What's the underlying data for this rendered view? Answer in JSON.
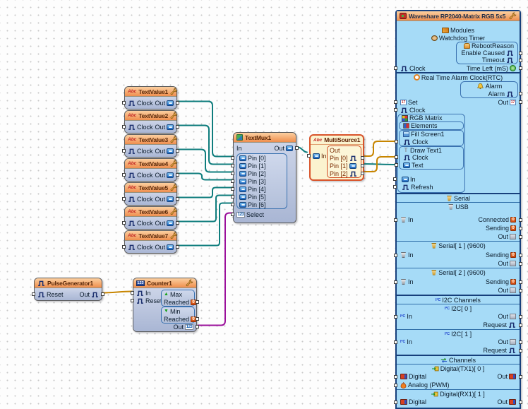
{
  "labels": {
    "clock": "Clock",
    "out": "Out",
    "in": "In",
    "reset": "Reset",
    "select": "Select",
    "text": "Text",
    "refresh": "Refresh",
    "set": "Set",
    "alarm": "Alarm",
    "max": "Max",
    "min": "Min",
    "reached": "Reached",
    "sending": "Sending",
    "connected": "Connected",
    "request": "Request",
    "digital": "Digital",
    "analog": "Analog (PWM)",
    "reboot_reason": "RebootReason",
    "enable_caused": "Enable Caused",
    "timeout": "Timeout",
    "time_left": "Time Left (mS)"
  },
  "text_values": [
    "TextValue1",
    "TextValue2",
    "TextValue3",
    "TextValue4",
    "TextValue5",
    "TextValue6",
    "TextValue7"
  ],
  "text_mux": {
    "title": "TextMux1",
    "pins": [
      "Pin [0]",
      "Pin [1]",
      "Pin [2]",
      "Pin [3]",
      "Pin [4]",
      "Pin [5]",
      "Pin [6]"
    ]
  },
  "multi_source": {
    "title": "MultiSource1",
    "pins": [
      "Pin [0]",
      "Pin [1]",
      "Pin [2]"
    ]
  },
  "pulse_generator": {
    "title": "PulseGenerator1"
  },
  "counter": {
    "title": "Counter1"
  },
  "board": {
    "title": "Waveshare RP2040-Matrix RGB 5x5",
    "modules": "Modules",
    "watchdog": "Watchdog Timer",
    "rtc": "Real Time Alarm Clock(RTC)",
    "rgb_matrix": "RGB Matrix",
    "elements": "Elements",
    "fill_screen": "Fill Screen1",
    "draw_text": "Draw Text1",
    "serial": "Serial",
    "usb": "USB",
    "serial1": "Serial[ 1 ] (9600)",
    "serial2": "Serial[ 2 ] (9600)",
    "i2c": "I2C Channels",
    "i2c0": "I2C[ 0 ]",
    "i2c1": "I2C[ 1 ]",
    "channels": "Channels",
    "tx": "Digital(TX1)[ 0 ]",
    "rx": "Digital(RX1)[ 1 ]"
  },
  "wire_colors": {
    "text": "#0f7d7d",
    "clock": "#c78500",
    "integer": "#9b109b"
  },
  "theme": {
    "header_orange": "#ef8e4e",
    "panel_blue": "#a6dbf7",
    "block_body": "#b9c4dd",
    "selected_border": "#d9542b"
  }
}
